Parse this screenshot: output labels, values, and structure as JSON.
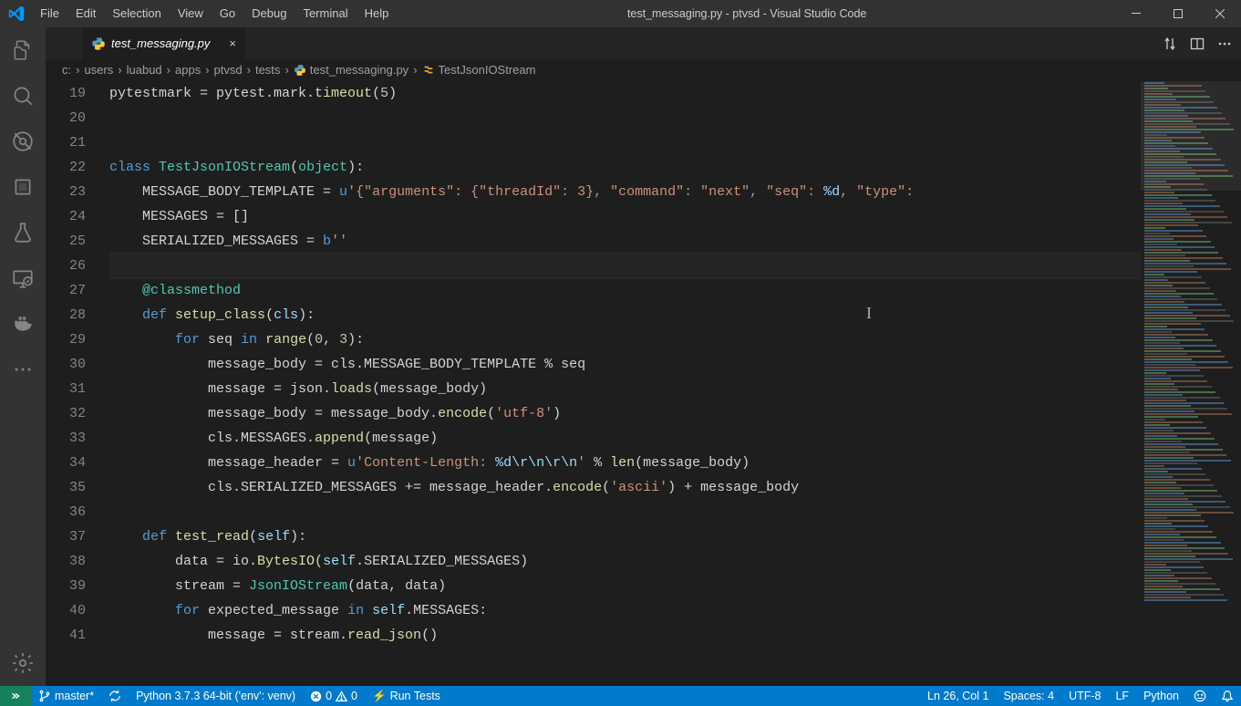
{
  "window": {
    "title": "test_messaging.py - ptvsd - Visual Studio Code"
  },
  "menu": [
    "File",
    "Edit",
    "Selection",
    "View",
    "Go",
    "Debug",
    "Terminal",
    "Help"
  ],
  "tab": {
    "filename": "test_messaging.py"
  },
  "breadcrumbs": {
    "items": [
      "c:",
      "users",
      "luabud",
      "apps",
      "ptvsd",
      "tests"
    ],
    "file": "test_messaging.py",
    "symbol": "TestJsonIOStream"
  },
  "activity_items": [
    "files",
    "search",
    "source-control",
    "debug",
    "extensions",
    "test",
    "remote",
    "docker"
  ],
  "code": {
    "first_line": 19,
    "lines": [
      {
        "n": 19,
        "html": "pytestmark = pytest.mark.<span class='tok-fn'>timeout</span>(<span class='tok-num'>5</span>)"
      },
      {
        "n": 20,
        "html": ""
      },
      {
        "n": 21,
        "html": ""
      },
      {
        "n": 22,
        "html": "<span class='tok-kw'>class</span> <span class='tok-cls'>TestJsonIOStream</span>(<span class='tok-cls'>object</span>):"
      },
      {
        "n": 23,
        "html": "    MESSAGE_BODY_TEMPLATE = <span class='tok-kw'>u</span><span class='tok-str'>'{\"arguments\": {\"threadId\": 3}, \"command\": \"next\", \"seq\": </span><span class='tok-var'>%d</span><span class='tok-str'>, \"type\":</span>"
      },
      {
        "n": 24,
        "html": "    MESSAGES = []"
      },
      {
        "n": 25,
        "html": "    SERIALIZED_MESSAGES = <span class='tok-kw'>b</span><span class='tok-str'>''</span>"
      },
      {
        "n": 26,
        "html": ""
      },
      {
        "n": 27,
        "html": "    <span class='tok-dec'>@classmethod</span>"
      },
      {
        "n": 28,
        "html": "    <span class='tok-kw'>def</span> <span class='tok-fn'>setup_class</span>(<span class='tok-var'>cls</span>):"
      },
      {
        "n": 29,
        "html": "        <span class='tok-kw'>for</span> seq <span class='tok-kw'>in</span> <span class='tok-fn'>range</span>(<span class='tok-num'>0</span>, <span class='tok-num'>3</span>):"
      },
      {
        "n": 30,
        "html": "            message_body = cls.MESSAGE_BODY_TEMPLATE % seq"
      },
      {
        "n": 31,
        "html": "            message = json.<span class='tok-fn'>loads</span>(message_body)"
      },
      {
        "n": 32,
        "html": "            message_body = message_body.<span class='tok-fn'>encode</span>(<span class='tok-str'>'utf-8'</span>)"
      },
      {
        "n": 33,
        "html": "            cls.MESSAGES.<span class='tok-fn'>append</span>(message)"
      },
      {
        "n": 34,
        "html": "            message_header = <span class='tok-kw'>u</span><span class='tok-str'>'Content-Length: </span><span class='tok-var'>%d\\r\\n\\r\\n</span><span class='tok-str'>'</span> % <span class='tok-fn'>len</span>(message_body)"
      },
      {
        "n": 35,
        "html": "            cls.SERIALIZED_MESSAGES += message_header.<span class='tok-fn'>encode</span>(<span class='tok-str'>'ascii'</span>) + message_body"
      },
      {
        "n": 36,
        "html": ""
      },
      {
        "n": 37,
        "html": "    <span class='tok-kw'>def</span> <span class='tok-fn'>test_read</span>(<span class='tok-self'>self</span>):"
      },
      {
        "n": 38,
        "html": "        data = io.<span class='tok-fn'>BytesIO</span>(<span class='tok-self'>self</span>.SERIALIZED_MESSAGES)"
      },
      {
        "n": 39,
        "html": "        stream = <span class='tok-cls'>JsonIOStream</span>(data, data)"
      },
      {
        "n": 40,
        "html": "        <span class='tok-kw'>for</span> expected_message <span class='tok-kw'>in</span> <span class='tok-self'>self</span>.MESSAGES:"
      },
      {
        "n": 41,
        "html": "            message = stream.<span class='tok-fn'>read_json</span>()"
      }
    ],
    "current_line": 26
  },
  "statusbar": {
    "branch": "master*",
    "python": "Python 3.7.3 64-bit ('env': venv)",
    "errors": "0",
    "warnings": "0",
    "run_tests": "Run Tests",
    "ln_col": "Ln 26, Col 1",
    "spaces": "Spaces: 4",
    "encoding": "UTF-8",
    "eol": "LF",
    "language": "Python"
  }
}
